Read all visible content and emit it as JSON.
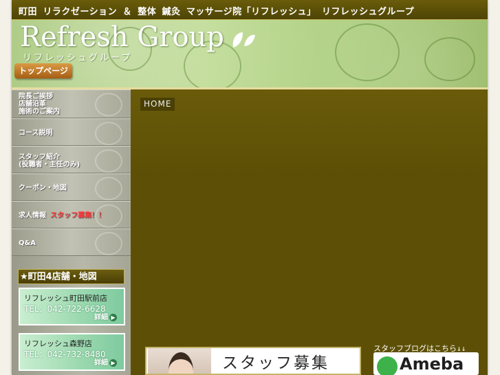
{
  "header": {
    "tagline": "町田 リラクゼーション ＆ 整体 鍼灸 マッサージ院「リフレッシュ」 リフレッシュグループ",
    "logo_title": "Refresh Group",
    "logo_kana": "リフレッシュグループ",
    "top_button_label": "トップページ"
  },
  "sidebar": {
    "nav": [
      {
        "lines": [
          "院長ご挨拶",
          "店舗沿革",
          "施術のご案内"
        ]
      },
      {
        "lines": [
          "コース説明"
        ]
      },
      {
        "lines": [
          "スタッフ紹介",
          "(役職者・主任のみ)"
        ]
      },
      {
        "lines": [
          "クーポン・地図"
        ]
      },
      {
        "lines": [
          "求人情報"
        ],
        "highlight": "スタッフ募集！！"
      },
      {
        "lines": [
          "Q&A"
        ]
      }
    ],
    "map_header": "★町田4店舗・地図",
    "stores": [
      {
        "name": "リフレッシュ町田駅前店",
        "tel": "TEL：042-722-6628",
        "detail": "詳細"
      },
      {
        "name": "リフレッシュ森野店",
        "tel": "TEL：042-732-8480",
        "detail": "詳細"
      }
    ]
  },
  "main": {
    "breadcrumb": "HOME",
    "recruit_banner_title": "スタッフ募集",
    "ameba_caption": "スタッフブログはこちら↓↓",
    "ameba_logo_text": "Ameba"
  },
  "colors": {
    "frame_olive": "#5d5006",
    "banner_green": "#b9d88b",
    "button_orange": "#c27a2a",
    "card_mint": "#9ad8ae"
  }
}
